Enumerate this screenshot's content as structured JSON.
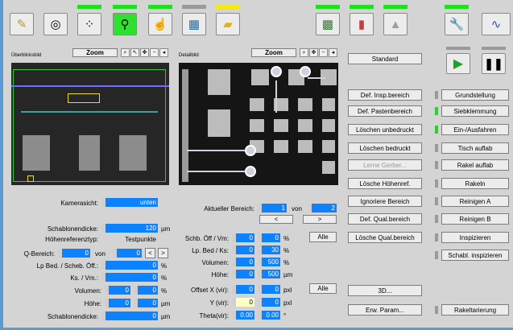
{
  "toolbar": {
    "icons": [
      "notes-icon",
      "circle-target-icon",
      "dots-icon",
      "lightbulb-icon",
      "hand-icon",
      "grid-icon",
      "folder-icon",
      "board-icon",
      "tower-icon",
      "cone-icon",
      "wrench-icon",
      "wave-icon"
    ],
    "colors": {
      "green": "#1ee01e",
      "gray": "#9a9a9a",
      "yellow": "#f6e714"
    }
  },
  "overview": {
    "title": "Überblicksbild",
    "zoom": "Zoom"
  },
  "detail": {
    "title": "Detailbild",
    "zoom": "Zoom"
  },
  "left": {
    "kamerasicht_label": "Kamerasicht:",
    "kamerasicht_value": "unten",
    "schablonendicke_label": "Schablonendicke:",
    "schablonendicke_value": "120",
    "schablonendicke_unit": "µm",
    "hoehenreferenztyp_label": "Höhenreferenztyp:",
    "hoehenreferenztyp_value": "Testpunkte",
    "q_bereich_label": "Q-Bereich:",
    "q_from": "0",
    "q_von": "von",
    "q_to": "0",
    "prev": "<",
    "next": ">",
    "lp_label": "Lp Bed. / Scheb. Öff.:",
    "lp_value": "0",
    "lp_unit": "%",
    "ks_label": "Ks. / Vm.:",
    "ks_value": "0",
    "ks_unit": "%",
    "volumen_label": "Volumen:",
    "volumen_a": "0",
    "volumen_b": "0",
    "volumen_unit": "%",
    "hoehe_label": "Höhe:",
    "hoehe_a": "0",
    "hoehe_b": "0",
    "hoehe_unit": "µm",
    "schablonendicke2_label": "Schablonendicke:",
    "schablonendicke2_value": "0",
    "schablonendicke2_unit": "µm"
  },
  "mid": {
    "bereich_label": "Aktueller Bereich:",
    "bereich_value": "1",
    "bereich_von": "von",
    "bereich_total": "2",
    "prev": "<",
    "next": ">",
    "schb_label": "Schb. Öff / Vm:",
    "schb_a": "0",
    "schb_b": "0",
    "schb_unit": "%",
    "lp_label": "Lp. Bed / Ks:",
    "lp_a": "0",
    "lp_b": "30",
    "lp_unit": "%",
    "vol_label": "Volumen:",
    "vol_a": "0",
    "vol_b": "500",
    "vol_unit": "%",
    "hoehe_label": "Höhe:",
    "hoehe_a": "0",
    "hoehe_b": "500",
    "hoehe_unit": "µm",
    "alle1": "Alle",
    "offx_label": "Offset X (vir):",
    "offx_a": "0",
    "offx_b": "0",
    "offx_unit": "pxl",
    "y_label": "Y (vir):",
    "y_a": "0",
    "y_b": "0",
    "y_unit": "pxl",
    "theta_label": "Theta(vir):",
    "theta_a": "0.00",
    "theta_b": "0.00",
    "theta_unit": "°",
    "alle2": "Alle"
  },
  "col3": {
    "standard": "Standard",
    "def_insp": "Def. Insp.bereich",
    "def_pasten": "Def. Pastenbereich",
    "loeschen_unbedruckt": "Löschen unbedruckt",
    "loeschen_bedruckt": "Löschen bedruckt",
    "lerne_gerber": "Lerne Gerber...",
    "loesche_hoehenref": "Lösche Höhenref.",
    "ignoriere_bereich": "Ignoriere Bereich",
    "def_qual": "Def. Qual.bereich",
    "loesche_qual": "Lösche Qual.bereich",
    "btn_3d": "3D...",
    "erw_param": "Erw. Param..."
  },
  "col4": {
    "grundstellung": "Grundstellung",
    "siebklemmung": "Siebklemmung",
    "ein_aus": "Ein-/Ausfahren",
    "tisch_auflab": "Tisch auflab",
    "rakel_auflab": "Rakel auflab",
    "rakeln": "Rakeln",
    "reinigen_a": "Reinigen A",
    "reinigen_b": "Reinigen B",
    "inspizieren": "Inspizieren",
    "schabl_inspizieren": "Schabl. inspizieren",
    "rakeltarierung": "Rakeltarierung",
    "play_icon": "play-icon",
    "pause_icon": "pause-icon"
  }
}
